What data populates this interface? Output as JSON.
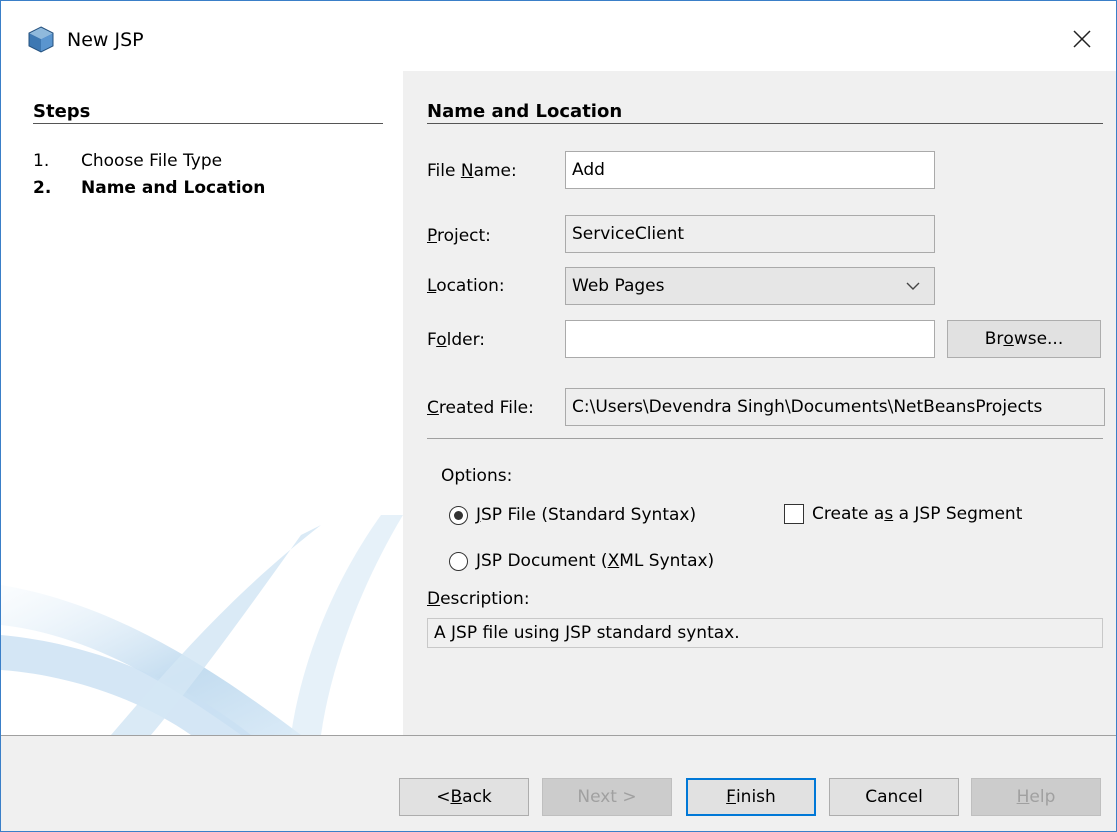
{
  "window": {
    "title": "New JSP",
    "close_symbol": "✕",
    "icon": "netbeans-cube-icon"
  },
  "steps": {
    "title": "Steps",
    "items": [
      {
        "number": "1.",
        "label": "Choose File Type"
      },
      {
        "number": "2.",
        "label": "Name and Location"
      }
    ]
  },
  "form": {
    "section_title": "Name and Location",
    "file_name_label_pre": "File ",
    "file_name_label_u": "N",
    "file_name_label_post": "ame:",
    "file_name_value": "Add",
    "project_label_u": "P",
    "project_label_post": "roject:",
    "project_value": "ServiceClient",
    "location_label_u": "L",
    "location_label_post": "ocation:",
    "location_value": "Web Pages",
    "folder_label_pre": "F",
    "folder_label_u": "o",
    "folder_label_post": "lder:",
    "folder_value": "",
    "browse_pre": "Br",
    "browse_u": "o",
    "browse_post": "wse...",
    "created_label_u": "C",
    "created_label_post": "reated File:",
    "created_value": "C:\\Users\\Devendra Singh\\Documents\\NetBeansProjects"
  },
  "options": {
    "title": "Options:",
    "jsp_file_u": "J",
    "jsp_file_post": "SP File (Standard Syntax)",
    "jsp_file_selected": true,
    "jsp_doc_pre": "JSP Document (",
    "jsp_doc_u": "X",
    "jsp_doc_post": "ML Syntax)",
    "jsp_doc_selected": false,
    "segment_pre": "Create a",
    "segment_u": "s",
    "segment_post": " a JSP Segment",
    "segment_checked": false
  },
  "description": {
    "label_u": "D",
    "label_post": "escription:",
    "text": "A JSP file using JSP standard syntax."
  },
  "buttons": {
    "back_pre": "< ",
    "back_u": "B",
    "back_post": "ack",
    "next": "Next >",
    "finish_u": "F",
    "finish_post": "inish",
    "cancel": "Cancel",
    "help_u": "H",
    "help_post": "elp"
  }
}
